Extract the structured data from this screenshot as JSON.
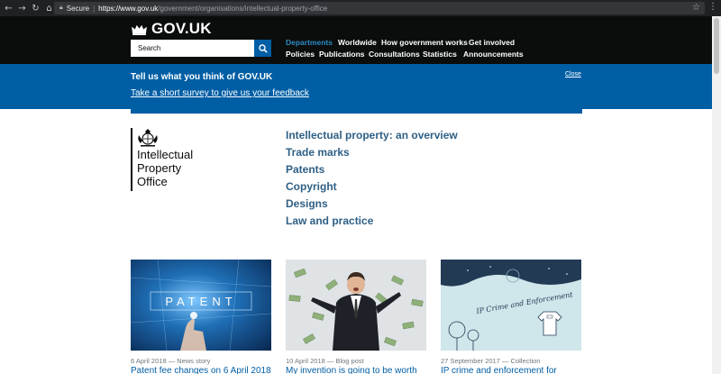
{
  "browser": {
    "secure_label": "Secure",
    "separator": "|",
    "url_host": "https://www.gov.uk",
    "url_path": "/government/organisations/intellectual-property-office"
  },
  "header": {
    "logotype": "GOV.UK",
    "search_placeholder": "Search",
    "nav_row1": [
      "Departments",
      "Worldwide",
      "How government works",
      "Get involved"
    ],
    "nav_row2": [
      "Policies",
      "Publications",
      "Consultations",
      "Statistics",
      "Announcements"
    ],
    "active_item": "Departments"
  },
  "survey": {
    "title": "Tell us what you think of GOV.UK",
    "link": "Take a short survey to give us your feedback",
    "close": "Close"
  },
  "organisation": {
    "name_lines": [
      "Intellectual",
      "Property",
      "Office"
    ],
    "topics": [
      "Intellectual property: an overview",
      "Trade marks",
      "Patents",
      "Copyright",
      "Designs",
      "Law and practice"
    ]
  },
  "cards": [
    {
      "meta": "6 April 2018 — News story",
      "title": "Patent fee changes on 6 April 2018",
      "image_text": "PATENT"
    },
    {
      "meta": "10 April 2018 — Blog post",
      "title": "My invention is going to be worth"
    },
    {
      "meta": "27 September 2017 — Collection",
      "title": "IP crime and enforcement for",
      "image_text": "IP Crime and Enforcement"
    }
  ],
  "colors": {
    "header_bg": "#0b0c0c",
    "brand_blue": "#005ea5",
    "link_blue": "#2e5f85",
    "active_nav": "#2b8cc4"
  }
}
